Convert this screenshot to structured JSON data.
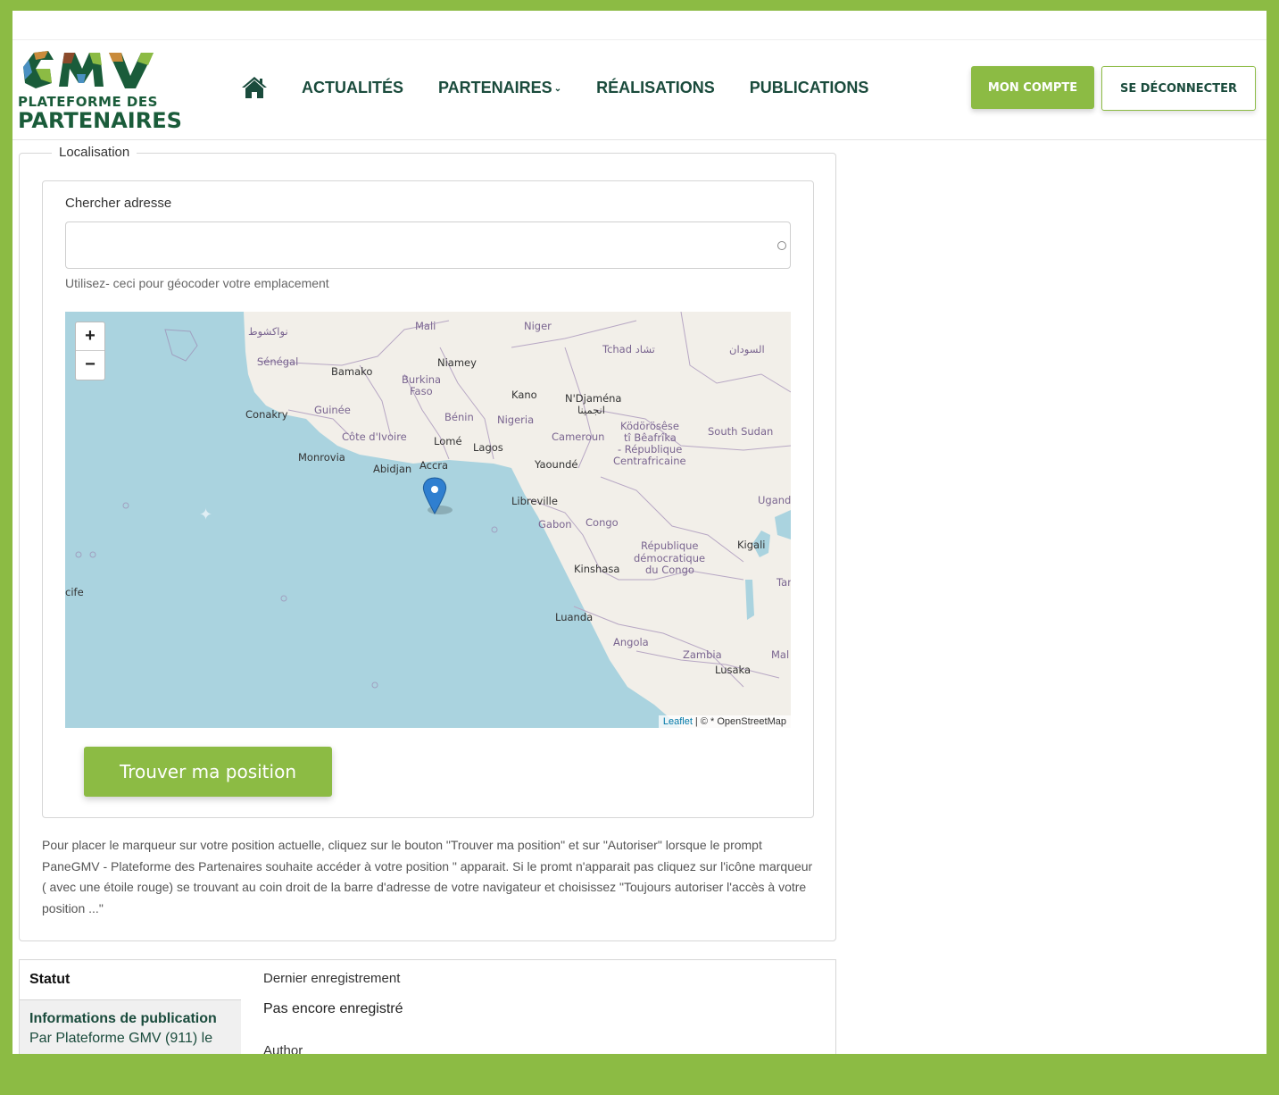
{
  "header": {
    "logo": {
      "line1": "PLATEFORME DES",
      "line2": "PARTENAIRES",
      "brand": "GMV"
    },
    "nav": {
      "home_icon": "home-icon",
      "items": [
        {
          "label": "ACTUALITÉS"
        },
        {
          "label": "PARTENAIRES",
          "has_dropdown": true
        },
        {
          "label": "RÉALISATIONS"
        },
        {
          "label": "PUBLICATIONS"
        }
      ]
    },
    "account_button": "MON COMPTE",
    "logout_button": "SE DÉCONNECTER"
  },
  "localisation": {
    "legend": "Localisation",
    "search_label": "Chercher adresse",
    "search_value": "",
    "search_placeholder": "",
    "hint": "Utilisez- ceci pour géocoder votre emplacement",
    "map": {
      "zoom_in": "+",
      "zoom_out": "−",
      "attribution_link": "Leaflet",
      "attribution_rest": " | © * OpenStreetMap",
      "labels": [
        "Mali",
        "Niger",
        "Tchad تشاد",
        "السودان",
        "نواكشوط",
        "Sénégal",
        "Bamako",
        "Niamey",
        "Burkina Faso",
        "Kano",
        "N'Djaména انجمينا",
        "Conakry",
        "Guinée",
        "Bénin",
        "Nigeria",
        "Côte d'Ivoire",
        "Lomé",
        "Lagos",
        "Cameroun",
        "Ködörösêse tî Bêafrîka - République Centrafricaine",
        "South Sudan",
        "Monrovia",
        "Abidjan",
        "Accra",
        "Yaoundé",
        "Libreville",
        "Ugand",
        "Gabon",
        "Congo",
        "République démocratique du Congo",
        "Kigali",
        "Kinshasa",
        "Tar",
        "cife",
        "Luanda",
        "Angola",
        "Zambia",
        "Mal",
        "Lusaka"
      ]
    },
    "find_button": "Trouver ma position",
    "help_text": "Pour placer le marqueur sur votre position actuelle, cliquez sur le bouton \"Trouver ma position\" et sur \"Autoriser\" lorsque le prompt PaneGMV - Plateforme des Partenaires souhaite accéder à votre position \" apparait. Si le promt n'apparait pas cliquez sur l'icône marqueur ( avec une étoile rouge) se trouvant au coin droit de la barre d'adresse de votre navigateur et choisissez \"Toujours autoriser l'accès à votre position ...\""
  },
  "status_panel": {
    "tab_status": "Statut",
    "tab_publication_title": "Informations de publication",
    "tab_publication_sub": "Par Plateforme GMV (911) le",
    "last_saved_label": "Dernier enregistrement",
    "last_saved_value": "Pas encore enregistré",
    "author_label": "Author"
  },
  "colors": {
    "brand_green": "#8cbb44",
    "dark_green": "#1a4b3c",
    "sea": "#aad3df",
    "land": "#f2efe9"
  }
}
